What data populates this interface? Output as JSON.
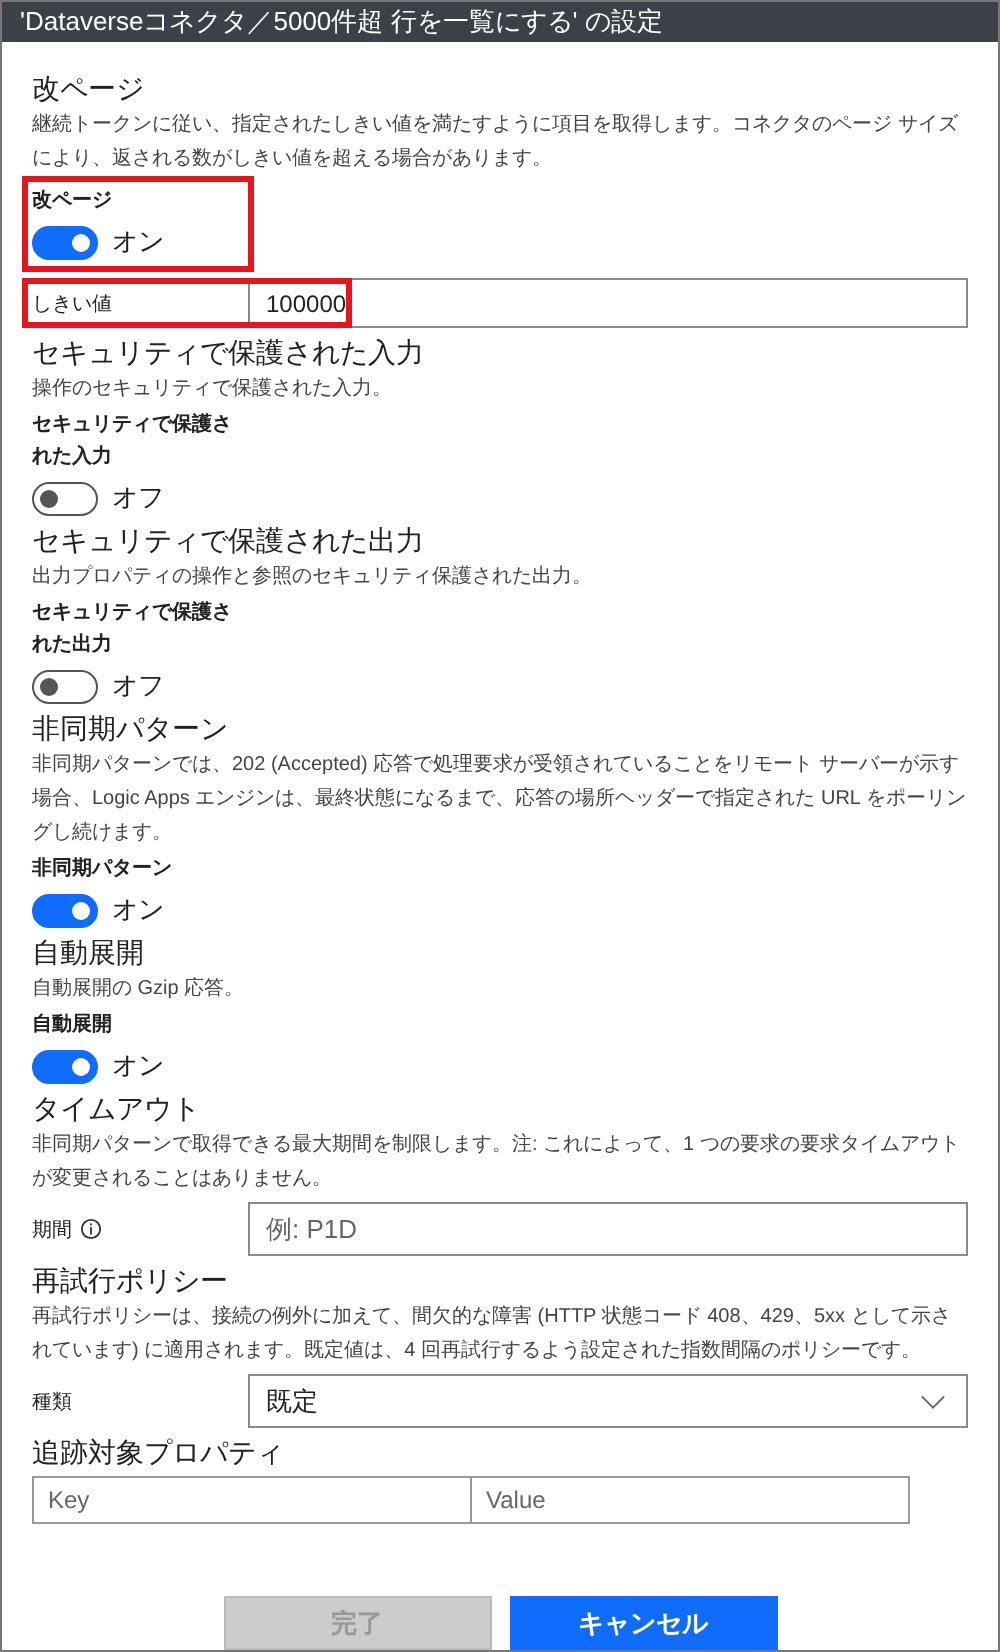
{
  "dialog": {
    "title": "'Dataverseコネクタ／5000件超 行を一覧にする' の設定"
  },
  "sections": [
    {
      "kind": "toggle",
      "heading": "改ページ",
      "description": "継続トークンに従い、指定されたしきい値を満たすように項目を取得します。コネクタのページ サイズにより、返される数がしきい値を超える場合があります。",
      "label": "改ページ",
      "on": true,
      "state_label": "オン",
      "highlighted": true
    },
    {
      "kind": "field",
      "label": "しきい値",
      "value": "100000",
      "highlighted": true
    },
    {
      "kind": "toggle",
      "heading": "セキュリティで保護された入力",
      "description": "操作のセキュリティで保護された入力。",
      "label": "セキュリティで保護された入力",
      "on": false,
      "state_label": "オフ",
      "highlighted": false
    },
    {
      "kind": "toggle",
      "heading": "セキュリティで保護された出力",
      "description": "出力プロパティの操作と参照のセキュリティ保護された出力。",
      "label": "セキュリティで保護された出力",
      "on": false,
      "state_label": "オフ",
      "highlighted": false
    },
    {
      "kind": "toggle",
      "heading": "非同期パターン",
      "description": "非同期パターンでは、202 (Accepted) 応答で処理要求が受領されていることをリモート サーバーが示す場合、Logic Apps エンジンは、最終状態になるまで、応答の場所ヘッダーで指定された URL をポーリングし続けます。",
      "label": "非同期パターン",
      "on": true,
      "state_label": "オン",
      "highlighted": false
    },
    {
      "kind": "toggle",
      "heading": "自動展開",
      "description": "自動展開の Gzip 応答。",
      "label": "自動展開",
      "on": true,
      "state_label": "オン",
      "highlighted": false
    },
    {
      "kind": "input",
      "heading": "タイムアウト",
      "description": "非同期パターンで取得できる最大期間を制限します。注: これによって、1 つの要求の要求タイムアウトが変更されることはありません。",
      "label": "期間",
      "info": true,
      "placeholder": "例: P1D"
    },
    {
      "kind": "select",
      "heading": "再試行ポリシー",
      "description": "再試行ポリシーは、接続の例外に加えて、間欠的な障害 (HTTP 状態コード 408、429、5xx として示されています) に適用されます。既定値は、4 回再試行するよう設定された指数間隔のポリシーです。",
      "label": "種類",
      "value": "既定"
    },
    {
      "kind": "pairs",
      "heading": "追跡対象プロパティ",
      "key_placeholder": "Key",
      "value_placeholder": "Value"
    }
  ],
  "buttons": [
    {
      "label": "完了",
      "kind": "primary",
      "disabled": true
    },
    {
      "label": "キャンセル",
      "kind": "primary",
      "disabled": false
    }
  ]
}
